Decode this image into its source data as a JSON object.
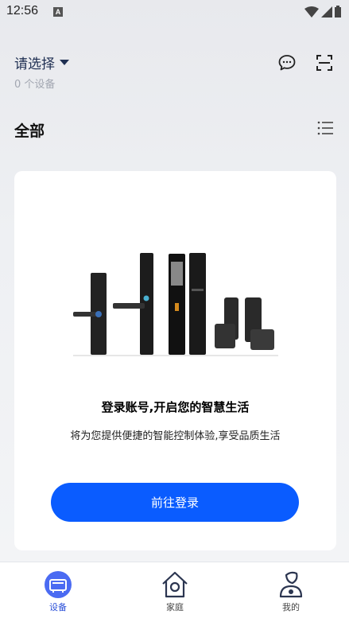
{
  "status_bar": {
    "time": "12:56",
    "notification_letter": "A"
  },
  "header": {
    "home_selector": "请选择",
    "device_count": "0 个设备"
  },
  "section": {
    "title": "全部"
  },
  "card": {
    "title": "登录账号,开启您的智慧生活",
    "subtitle": "将为您提供便捷的智能控制体验,享受品质生活",
    "login_button": "前往登录"
  },
  "bottom_nav": {
    "items": [
      {
        "label": "设备",
        "icon": "device-icon",
        "active": true
      },
      {
        "label": "家庭",
        "icon": "home-icon",
        "active": false
      },
      {
        "label": "我的",
        "icon": "profile-icon",
        "active": false
      }
    ]
  },
  "colors": {
    "accent": "#0a5cff",
    "nav_active": "#2a4fd8",
    "title_dark": "#1f2f52"
  }
}
